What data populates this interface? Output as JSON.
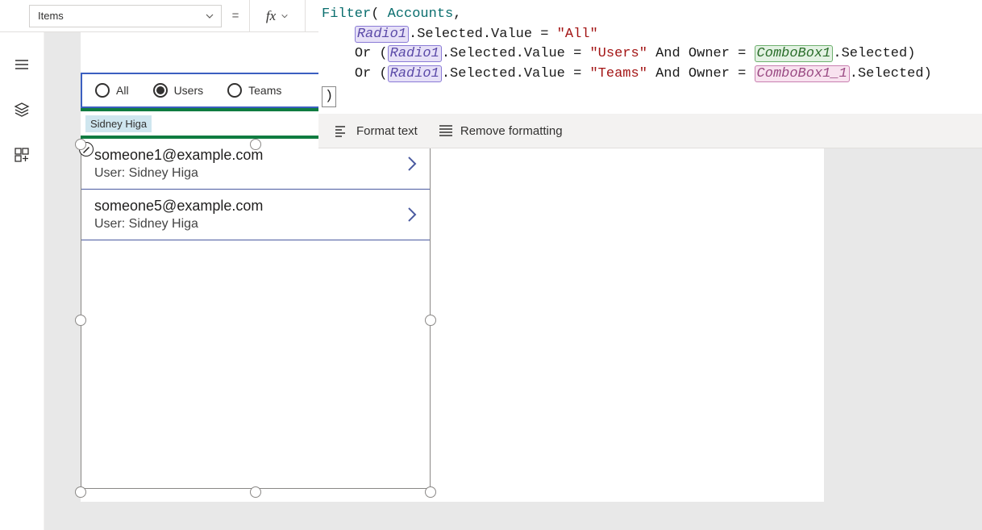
{
  "property_selector": {
    "value": "Items"
  },
  "formula": {
    "fn": "Filter",
    "source": "Accounts",
    "radio_ref": "Radio1",
    "combo1_ref": "ComboBox1",
    "combo2_ref": "ComboBox1_1",
    "val_all": "\"All\"",
    "val_users": "\"Users\"",
    "val_teams": "\"Teams\""
  },
  "formula_toolbar": {
    "format": "Format text",
    "remove": "Remove formatting"
  },
  "radio": {
    "options": [
      "All",
      "Users",
      "Teams"
    ],
    "selected_index": 1
  },
  "combobox": {
    "selected": "Sidney Higa"
  },
  "gallery": {
    "rows": [
      {
        "title": "someone1@example.com",
        "sub": "User: Sidney Higa"
      },
      {
        "title": "someone5@example.com",
        "sub": "User: Sidney Higa"
      }
    ]
  }
}
